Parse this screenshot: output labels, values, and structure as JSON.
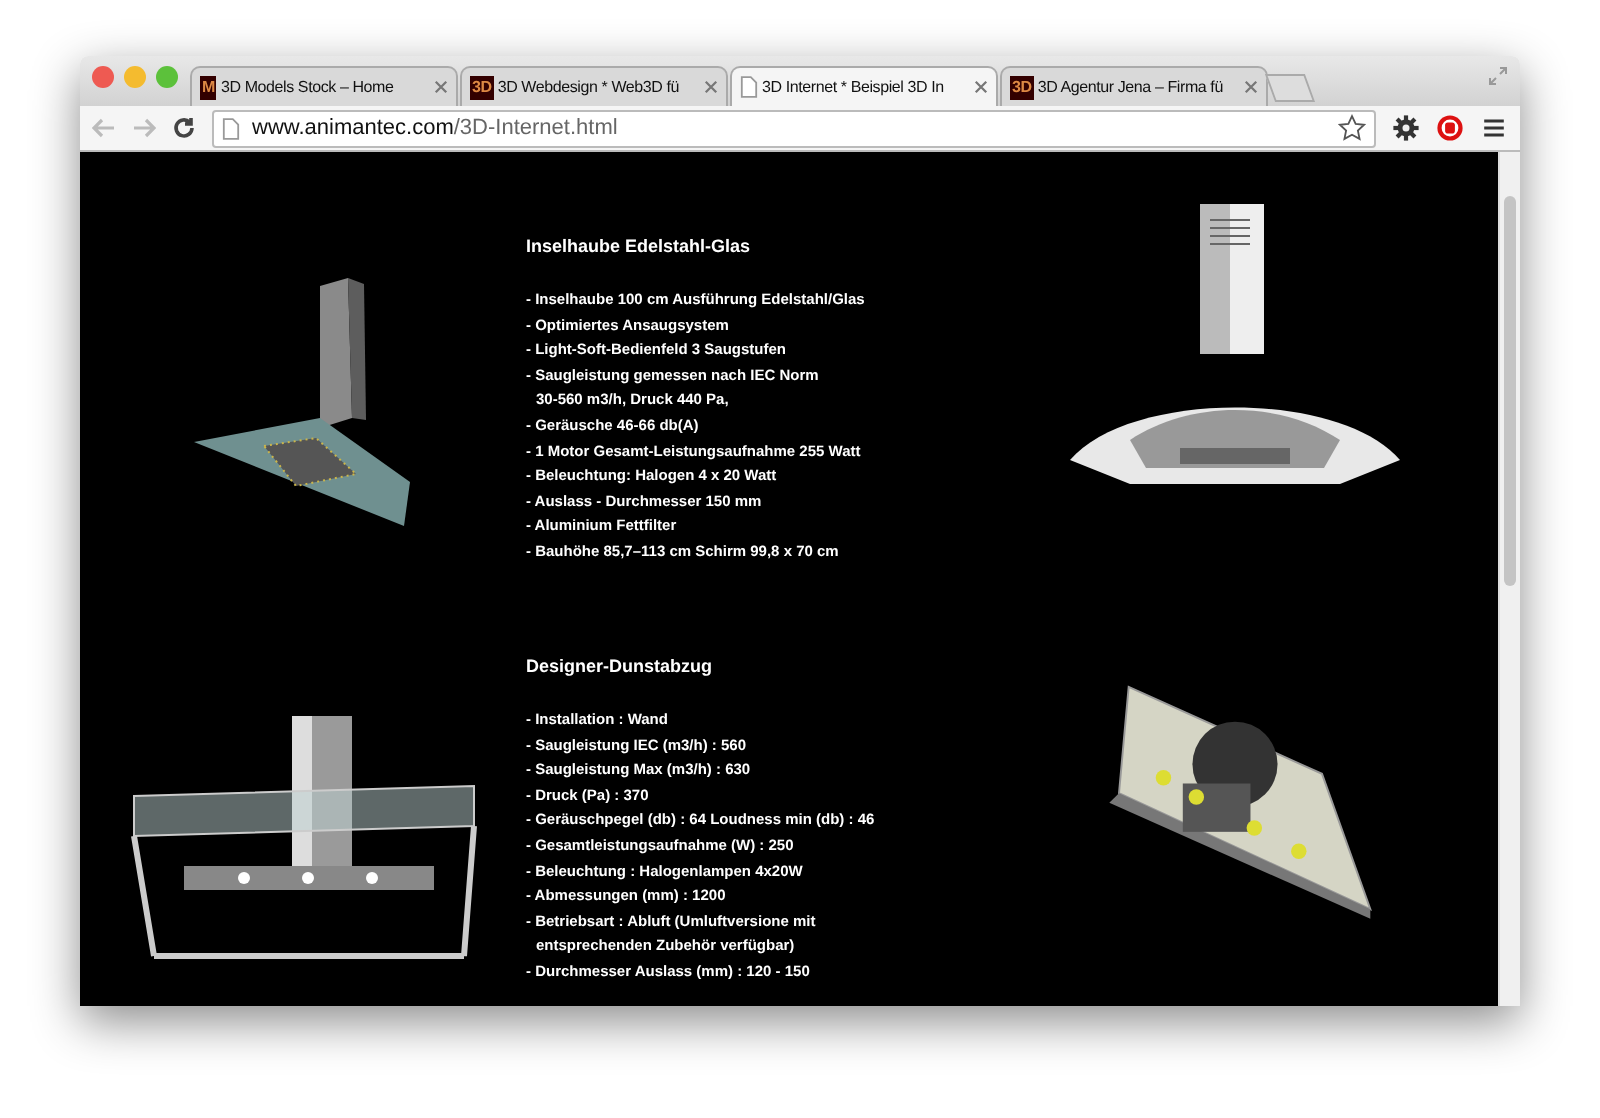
{
  "tabs": [
    {
      "label": "3D Models Stock – Home",
      "icon": "M",
      "selected": false
    },
    {
      "label": "3D Webdesign * Web3D fü",
      "icon": "3D",
      "selected": false
    },
    {
      "label": "3D Internet * Beispiel 3D In",
      "selected": true
    },
    {
      "label": "3D Agentur Jena – Firma fü",
      "icon": "3D",
      "selected": false
    }
  ],
  "address_bar": {
    "domain": "www.animantec.com",
    "path": "/3D-Internet.html"
  },
  "products": [
    {
      "title": "Inselhaube Edelstahl-Glas",
      "lines": [
        {
          "text": "- Inselhaube 100 cm Ausführung Edelstahl/Glas",
          "continuation": false
        },
        {
          "text": "- Optimiertes Ansaugsystem",
          "continuation": false
        },
        {
          "text": "- Light-Soft-Bedienfeld 3 Saugstufen",
          "continuation": false
        },
        {
          "text": "- Saugleistung gemessen nach IEC Norm",
          "continuation": false
        },
        {
          "text": "30-560 m3/h, Druck 440 Pa,",
          "continuation": true
        },
        {
          "text": "- Geräusche 46-66 db(A)",
          "continuation": false
        },
        {
          "text": "- 1 Motor Gesamt-Leistungsaufnahme 255 Watt",
          "continuation": false
        },
        {
          "text": "- Beleuchtung: Halogen 4 x 20 Watt",
          "continuation": false
        },
        {
          "text": "- Auslass - Durchmesser 150 mm",
          "continuation": false
        },
        {
          "text": "- Aluminium Fettfilter",
          "continuation": false
        },
        {
          "text": "- Bauhöhe 85,7–113 cm Schirm 99,8 x 70 cm",
          "continuation": false
        }
      ]
    },
    {
      "title": "Designer-Dunstabzug",
      "lines": [
        {
          "text": "- Installation : Wand",
          "continuation": false
        },
        {
          "text": "- Saugleistung IEC (m3/h) : 560",
          "continuation": false
        },
        {
          "text": "- Saugleistung Max (m3/h) : 630",
          "continuation": false
        },
        {
          "text": "- Druck (Pa) : 370",
          "continuation": false
        },
        {
          "text": "- Geräuschpegel (db) : 64 Loudness min (db) : 46",
          "continuation": false
        },
        {
          "text": "- Gesamtleistungsaufnahme (W) : 250",
          "continuation": false
        },
        {
          "text": "- Beleuchtung : Halogenlampen 4x20W",
          "continuation": false
        },
        {
          "text": "- Abmessungen (mm) : 1200",
          "continuation": false
        },
        {
          "text": "- Betriebsart : Abluft (Umluftversione mit",
          "continuation": false
        },
        {
          "text": "entsprechenden Zubehör verfügbar)",
          "continuation": true
        },
        {
          "text": "- Durchmesser Auslass (mm) : 120 - 150",
          "continuation": false
        }
      ]
    }
  ]
}
